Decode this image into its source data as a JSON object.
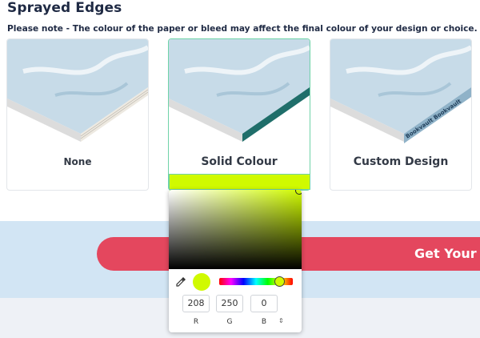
{
  "header": {
    "title": "Sprayed Edges",
    "note": "Please note - The colour of the paper or bleed may affect the final colour of your design or choice."
  },
  "options": [
    {
      "label": "None",
      "edge_color": "#f1eee8"
    },
    {
      "label": "Solid Colour",
      "edge_color": "#1f6e6a"
    },
    {
      "label": "Custom Design",
      "edge_text": "Bookvault Bookvault"
    }
  ],
  "selected_color": "#d0fa00",
  "color_picker": {
    "r_value": "208",
    "g_value": "250",
    "b_value": "0",
    "r_label": "R",
    "g_label": "G",
    "b_label": "B",
    "mode_toggle": "⇕"
  },
  "cta": {
    "label": "Get Your O"
  },
  "colors": {
    "title": "#1f2a44",
    "cta": "#e4475e",
    "selected_border": "#6fd3a8",
    "band": "#d2e5f4"
  }
}
